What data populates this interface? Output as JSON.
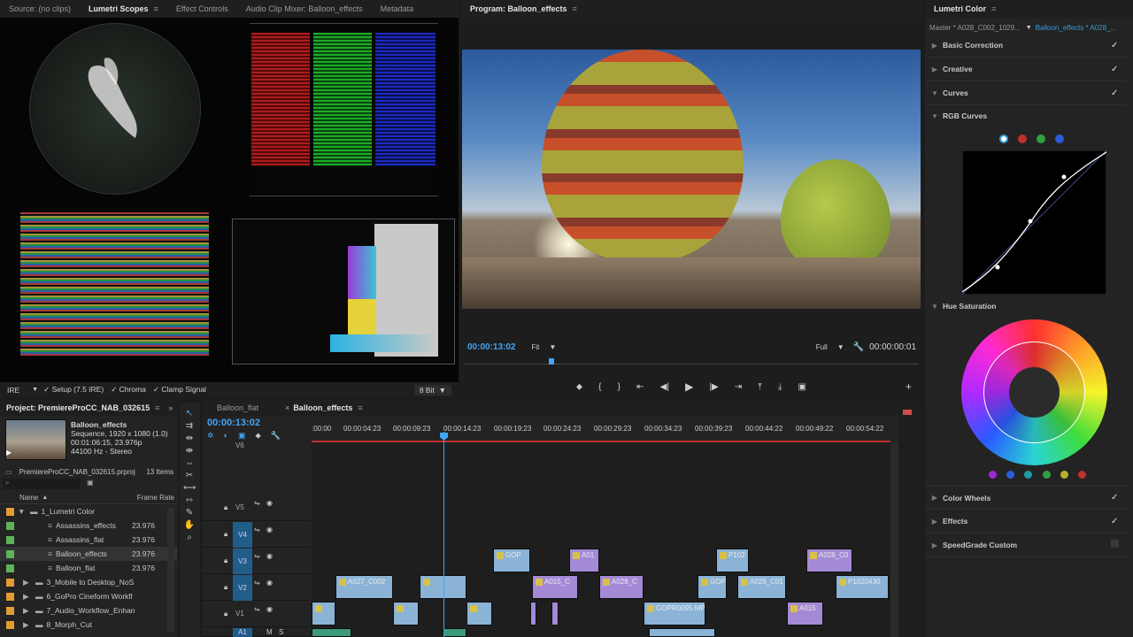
{
  "scopes_panel": {
    "tabs": [
      "Source: (no clips)",
      "Lumetri Scopes",
      "Effect Controls",
      "Audio Clip Mixer: Balloon_effects",
      "Metadata"
    ],
    "active_tab": "Lumetri Scopes",
    "footer": {
      "scale": "IRE",
      "setup": "Setup (7.5 IRE)",
      "chroma": "Chroma",
      "clamp": "Clamp Signal",
      "bit_depth": "8 Bit"
    }
  },
  "program_panel": {
    "title": "Program: Balloon_effects",
    "timecode_left": "00:00:13:02",
    "fit": "Fit",
    "resolution": "Full",
    "timecode_right": "00:00:00:01"
  },
  "lumetri": {
    "title": "Lumetri Color",
    "master_tab": "Master * A028_C002_1029...",
    "effect_tab": "Balloon_effects * A028_...",
    "sections": [
      {
        "label": "Basic Correction",
        "checked": "✓"
      },
      {
        "label": "Creative",
        "checked": "✓"
      },
      {
        "label": "Curves",
        "checked": "✓"
      }
    ],
    "rgb_curves_label": "RGB Curves",
    "hue_sat_label": "Hue Saturation",
    "bottom_sections": [
      {
        "label": "Color Wheels",
        "checked": "✓"
      },
      {
        "label": "Effects",
        "checked": "✓"
      },
      {
        "label": "SpeedGrade Custom",
        "checked": ""
      }
    ],
    "curve_dots": [
      "#ffffff",
      "#c0302f",
      "#2ea043",
      "#2d5bd8"
    ],
    "hue_dots": [
      "#9a2ad4",
      "#2d5bd8",
      "#1d9ba0",
      "#2ea043",
      "#b9b02a",
      "#c0302f"
    ]
  },
  "project": {
    "title": "Project: PremiereProCC_NAB_032615",
    "clip_name": "Balloon_effects",
    "clip_info1": "Sequence, 1920 x 1080 (1.0)",
    "clip_info2": "00:01:06:15, 23.976p",
    "clip_info3": "44100 Hz - Stereo",
    "file": "PremiereProCC_NAB_032615.prproj",
    "count": "13 Items",
    "col_name": "Name",
    "col_rate": "Frame Rate",
    "rows": [
      {
        "name": "1_Lumetri Color",
        "rate": "",
        "color": "#e39b33",
        "indent": 0,
        "folder": true,
        "open": true
      },
      {
        "name": "Assassins_effects",
        "rate": "23.976",
        "color": "#5db35a",
        "indent": 1,
        "folder": false
      },
      {
        "name": "Assassins_flat",
        "rate": "23.976",
        "color": "#5db35a",
        "indent": 1,
        "folder": false
      },
      {
        "name": "Balloon_effects",
        "rate": "23.976",
        "color": "#5db35a",
        "indent": 1,
        "folder": false
      },
      {
        "name": "Balloon_flat",
        "rate": "23.976",
        "color": "#5db35a",
        "indent": 1,
        "folder": false
      },
      {
        "name": "3_Mobile to Desktop_NoS",
        "rate": "",
        "color": "#e39b33",
        "indent": 0,
        "folder": true
      },
      {
        "name": "6_GoPro Cineform Workfl",
        "rate": "",
        "color": "#e39b33",
        "indent": 0,
        "folder": true
      },
      {
        "name": "7_Audio_Workflow_Enhan",
        "rate": "",
        "color": "#e39b33",
        "indent": 0,
        "folder": true
      },
      {
        "name": "8_Morph_Cut",
        "rate": "",
        "color": "#e39b33",
        "indent": 0,
        "folder": true
      }
    ]
  },
  "timeline": {
    "tabs": [
      "Balloon_flat",
      "Balloon_effects"
    ],
    "timecode": "00:00:13:02",
    "ruler": [
      ":00:00",
      "00:00:04:23",
      "00:00:09:23",
      "00:00:14:23",
      "00:00:19:23",
      "00:00:24:23",
      "00:00:29:23",
      "00:00:34:23",
      "00:00:39:23",
      "00:00:44:22",
      "00:00:49:22",
      "00:00:54:22"
    ],
    "tracks": [
      "V6",
      "V5",
      "V4",
      "V3",
      "V2",
      "V1",
      "A1"
    ],
    "clips": {
      "v3": [
        "GOP",
        "A01",
        "P102",
        "A028_C0"
      ],
      "v2": [
        "A027_C002",
        "A015_C",
        "A028_C",
        "GOP",
        "A028_C01",
        "P1020430."
      ],
      "v1": [
        "GOPR0095.MP",
        "A015"
      ]
    }
  }
}
